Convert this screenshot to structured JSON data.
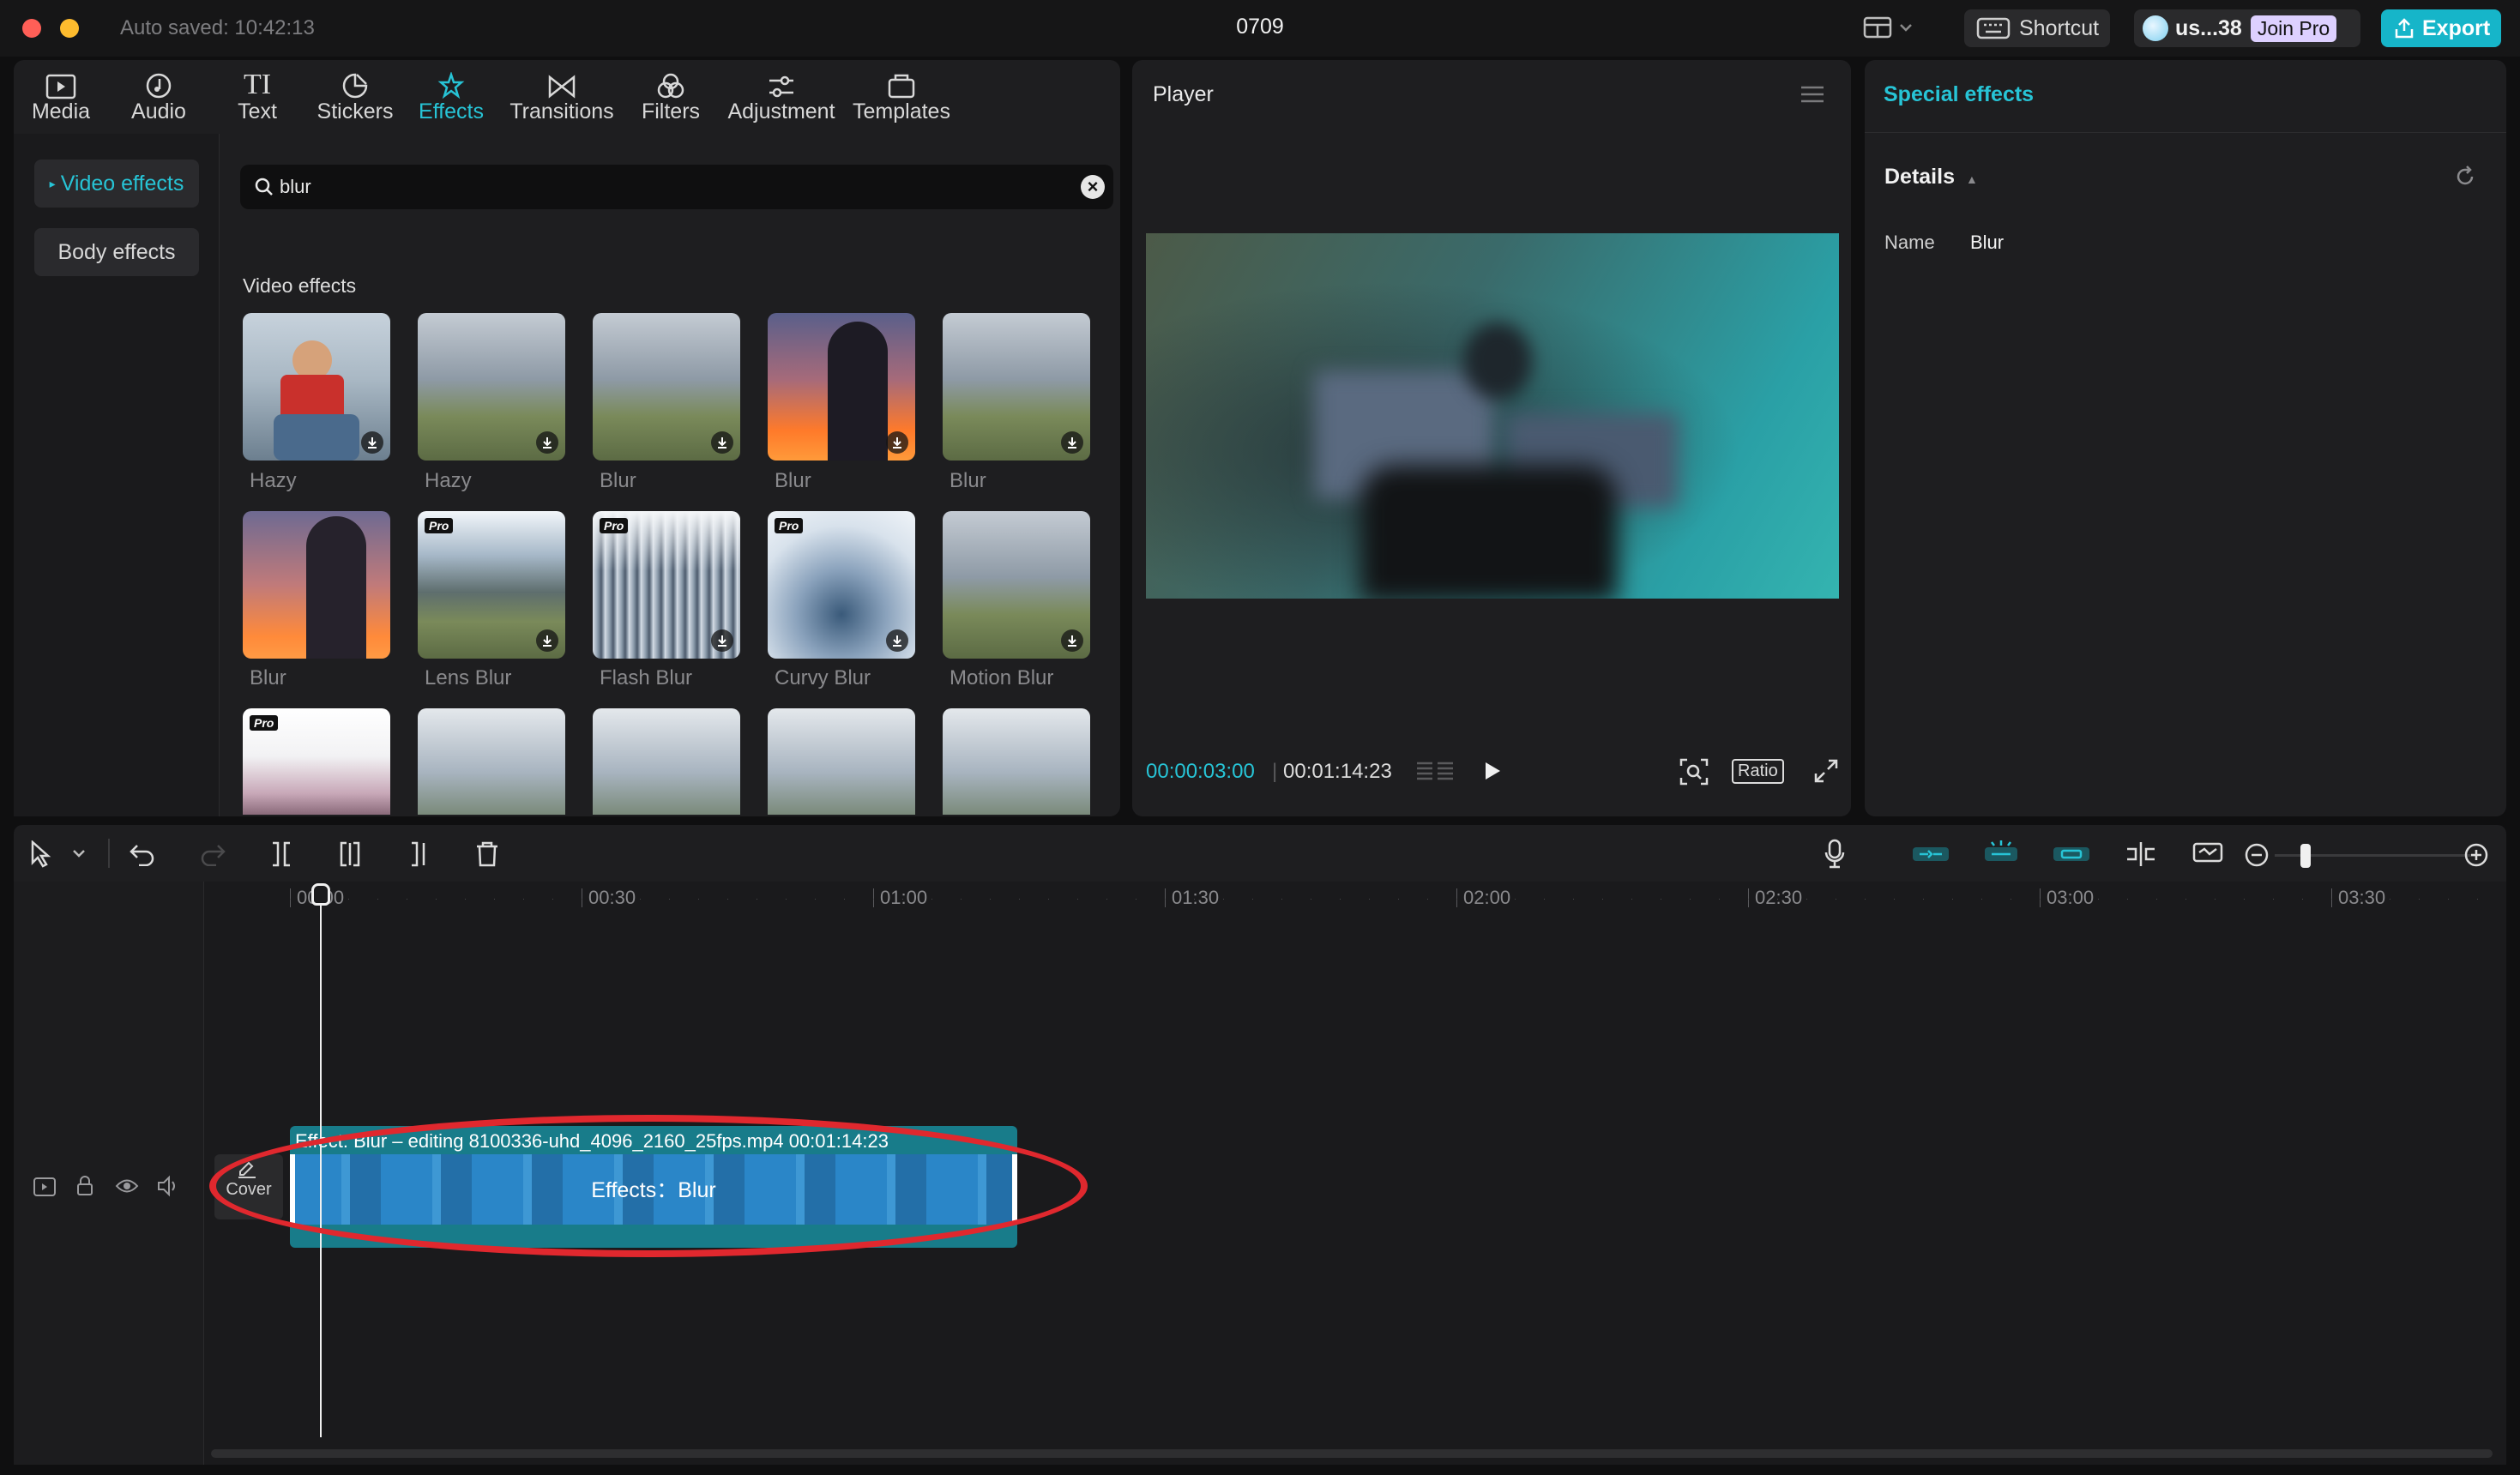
{
  "app": {
    "autosave": "Auto saved: 10:42:13",
    "doc_title": "0709",
    "shortcut_label": "Shortcut",
    "user_label": "us...38",
    "join_pro_label": "Join Pro",
    "export_label": "Export"
  },
  "toolbar": {
    "tabs": [
      {
        "label": "Media",
        "icon": "media-icon"
      },
      {
        "label": "Audio",
        "icon": "audio-icon"
      },
      {
        "label": "Text",
        "icon": "text-icon"
      },
      {
        "label": "Stickers",
        "icon": "sticker-icon"
      },
      {
        "label": "Effects",
        "icon": "effects-icon",
        "active": true
      },
      {
        "label": "Transitions",
        "icon": "transitions-icon"
      },
      {
        "label": "Filters",
        "icon": "filters-icon"
      },
      {
        "label": "Adjustment",
        "icon": "adjustment-icon"
      },
      {
        "label": "Templates",
        "icon": "templates-icon"
      }
    ]
  },
  "sidebar": {
    "items": [
      {
        "label": "Video effects",
        "active": true
      },
      {
        "label": "Body effects"
      }
    ]
  },
  "search": {
    "value": "blur"
  },
  "grid": {
    "heading": "Video effects",
    "items": [
      {
        "label": "Hazy"
      },
      {
        "label": "Hazy"
      },
      {
        "label": "Blur"
      },
      {
        "label": "Blur"
      },
      {
        "label": "Blur"
      },
      {
        "label": "Blur"
      },
      {
        "label": "Lens Blur",
        "pro": "Pro"
      },
      {
        "label": "Flash Blur",
        "pro": "Pro"
      },
      {
        "label": "Curvy Blur",
        "pro": "Pro"
      },
      {
        "label": "Motion Blur"
      }
    ],
    "pro_badge": "Pro"
  },
  "player": {
    "title": "Player",
    "current_time": "00:00:03:00",
    "total_time": "00:01:14:23",
    "ratio_label": "Ratio"
  },
  "effects_panel": {
    "title": "Special effects",
    "details_label": "Details",
    "name_key": "Name",
    "name_value": "Blur"
  },
  "timeline": {
    "ticks": [
      "00:00",
      "00:30",
      "01:00",
      "01:30",
      "02:00",
      "02:30",
      "03:00",
      "03:30"
    ],
    "clip_head": "Effect: Blur – editing  8100336-uhd_4096_2160_25fps.mp4  00:01:14:23",
    "clip_label": "Effects：Blur",
    "cover_label": "Cover"
  },
  "colors": {
    "accent": "#27c4d6",
    "export": "#16b5c9",
    "clip": "#2a86c8",
    "annotation": "#e0282e"
  }
}
